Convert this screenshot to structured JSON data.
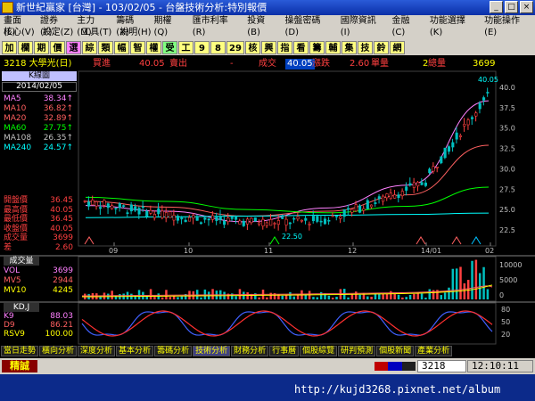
{
  "window": {
    "title": "新世紀贏家 [台灣] - 103/02/05 - 台盤技術分析:特別報價"
  },
  "menu": {
    "row1": [
      "畫面(L)",
      "證券(F)",
      "主力(M)",
      "籌碼(X)",
      "期權(Q)",
      "匯市利率(R)",
      "投資(B)",
      "操盤密碼(D)",
      "國際資訊(I)",
      "金融(C)",
      "功能選擇(K)",
      "功能操作(E)"
    ],
    "row2": [
      "核心(V)",
      "設定(Z)",
      "工具(T)",
      "說明(H)"
    ]
  },
  "toolbar": {
    "buttons": [
      "加",
      "欄",
      "期",
      "價",
      "選",
      "綜",
      "類",
      "幅",
      "智",
      "權",
      "受",
      "工",
      "9",
      "8",
      "29",
      "核",
      "興",
      "指",
      "看",
      "籌",
      "輔",
      "集",
      "技",
      "鈴",
      "網"
    ]
  },
  "quote": {
    "stock": "3218 大學光(日)",
    "buy_label": "買進",
    "buy_value": "40.05",
    "sell_label": "賣出",
    "sell_value": "-",
    "deal_label": "成交",
    "deal_value": "40.05",
    "change_label": "漲跌",
    "change_value": "2.60",
    "vol_label": "單量",
    "vol_value": "2",
    "total_label": "總量",
    "total_value": "3699"
  },
  "kline": {
    "button": "K線圖",
    "date": "2014/02/05",
    "ma": [
      {
        "label": "MA5",
        "value": "38.34",
        "color": "#ff80ff",
        "arrow": "↑"
      },
      {
        "label": "MA10",
        "value": "36.82",
        "color": "#ff6060",
        "arrow": "↑"
      },
      {
        "label": "MA20",
        "value": "32.89",
        "color": "#ff6060",
        "arrow": "↑"
      },
      {
        "label": "MA60",
        "value": "27.75",
        "color": "#00ff00",
        "arrow": "↑"
      },
      {
        "label": "MA108",
        "value": "26.35",
        "color": "#c0c0c0",
        "arrow": "↑"
      },
      {
        "label": "MA240",
        "value": "24.57",
        "color": "#00ffff",
        "arrow": "↑"
      }
    ],
    "ohlc": [
      {
        "label": "開盤價",
        "value": "36.45"
      },
      {
        "label": "最高價",
        "value": "40.05"
      },
      {
        "label": "最低價",
        "value": "36.45"
      },
      {
        "label": "收盤價",
        "value": "40.05"
      },
      {
        "label": "成交量",
        "value": "3699"
      },
      {
        "label": "差",
        "value": "2.60"
      }
    ],
    "high_label": "40.05",
    "low_label": "22.50",
    "y_ticks": [
      "40.0",
      "37.5",
      "35.0",
      "32.5",
      "30.0",
      "27.5",
      "25.0",
      "22.5"
    ],
    "x_ticks": [
      "09",
      "10",
      "11",
      "12",
      "14/01",
      "02"
    ]
  },
  "volume": {
    "title": "成交量",
    "rows": [
      {
        "label": "VOL",
        "value": "3699",
        "color": "#ff80ff"
      },
      {
        "label": "MV5",
        "value": "2944",
        "color": "#ff6060"
      },
      {
        "label": "MV10",
        "value": "4245",
        "color": "#ffff00"
      }
    ],
    "y_ticks": [
      "10000",
      "5000",
      "0"
    ]
  },
  "kd": {
    "title": "KD,J",
    "rows": [
      {
        "label": "K9",
        "value": "88.03",
        "color": "#ff80ff"
      },
      {
        "label": "D9",
        "value": "86.21",
        "color": "#ff6060"
      },
      {
        "label": "RSV9",
        "value": "100.00",
        "color": "#ffff00"
      }
    ],
    "y_ticks": [
      "80",
      "50",
      "20"
    ]
  },
  "chart_data": {
    "type": "line",
    "x": [
      "09",
      "10",
      "11",
      "12",
      "14/01",
      "02"
    ],
    "series": [
      {
        "name": "MA5",
        "values": [
          25.5,
          24.8,
          23.5,
          25.2,
          28.0,
          38.34
        ]
      },
      {
        "name": "MA20",
        "values": [
          26.0,
          25.3,
          24.2,
          24.8,
          26.8,
          32.89
        ]
      },
      {
        "name": "MA60",
        "values": [
          26.5,
          26.0,
          25.0,
          24.6,
          25.4,
          27.75
        ]
      },
      {
        "name": "MA240",
        "values": [
          24.0,
          24.1,
          24.2,
          24.3,
          24.4,
          24.57
        ]
      }
    ],
    "ylim": [
      22.5,
      40.0
    ]
  },
  "tabs": [
    "當日走勢",
    "橫向分析",
    "深度分析",
    "基本分析",
    "籌碼分析",
    "技術分析",
    "財務分析",
    "行事曆",
    "個股綜覽",
    "研判預測",
    "個股新聞",
    "產業分析"
  ],
  "active_tab": "技術分析",
  "status": {
    "mode": "精誠",
    "code": "3218",
    "clock": "12:10:11"
  },
  "watermark": "http://kujd3268.pixnet.net/album"
}
